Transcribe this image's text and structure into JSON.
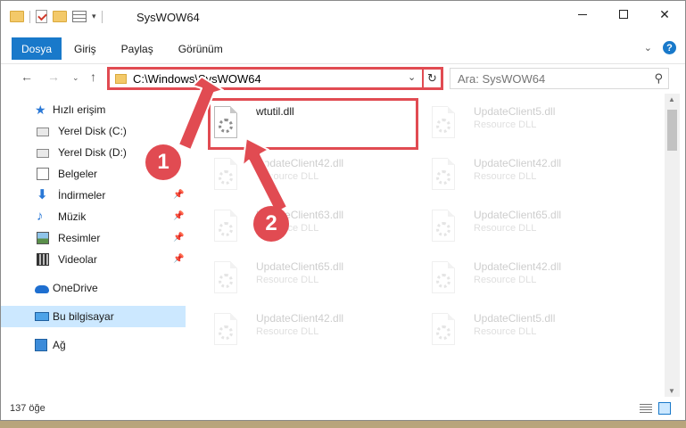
{
  "window": {
    "title": "SysWOW64"
  },
  "ribbon": {
    "tabs": [
      {
        "label": "Dosya"
      },
      {
        "label": "Giriş"
      },
      {
        "label": "Paylaş"
      },
      {
        "label": "Görünüm"
      }
    ],
    "help_label": "?"
  },
  "address": {
    "path": "C:\\Windows\\SysWOW64",
    "search_placeholder": "Ara: SysWOW64"
  },
  "sidebar": {
    "items": [
      {
        "label": "Hızlı erişim",
        "icon": "star-icon"
      },
      {
        "label": "Yerel Disk (C:)",
        "icon": "drive-icon"
      },
      {
        "label": "Yerel Disk (D:)",
        "icon": "drive-icon"
      },
      {
        "label": "Belgeler",
        "icon": "documents-icon"
      },
      {
        "label": "İndirmeler",
        "icon": "download-icon"
      },
      {
        "label": "Müzik",
        "icon": "music-icon"
      },
      {
        "label": "Resimler",
        "icon": "pictures-icon"
      },
      {
        "label": "Videolar",
        "icon": "videos-icon"
      },
      {
        "label": "OneDrive",
        "icon": "onedrive-icon"
      },
      {
        "label": "Bu bilgisayar",
        "icon": "this-pc-icon"
      },
      {
        "label": "Ağ",
        "icon": "network-icon"
      }
    ]
  },
  "files": [
    {
      "name": "wtutil.dll",
      "type": ""
    },
    {
      "name": "UpdateClient5.dll",
      "type": "Resource DLL"
    },
    {
      "name": "UpdateClient42.dll",
      "type": "Resource DLL"
    },
    {
      "name": "UpdateClient42.dll",
      "type": "Resource DLL"
    },
    {
      "name": "UpdateClient63.dll",
      "type": "Resource DLL"
    },
    {
      "name": "UpdateClient65.dll",
      "type": "Resource DLL"
    },
    {
      "name": "UpdateClient65.dll",
      "type": "Resource DLL"
    },
    {
      "name": "UpdateClient42.dll",
      "type": "Resource DLL"
    },
    {
      "name": "UpdateClient42.dll",
      "type": "Resource DLL"
    },
    {
      "name": "UpdateClient5.dll",
      "type": "Resource DLL"
    }
  ],
  "status": {
    "item_count": "137 öğe"
  },
  "callouts": [
    "1",
    "2"
  ],
  "colors": {
    "accent": "#1979ca",
    "annotation": "#e14b52",
    "selected": "#cce8ff"
  }
}
